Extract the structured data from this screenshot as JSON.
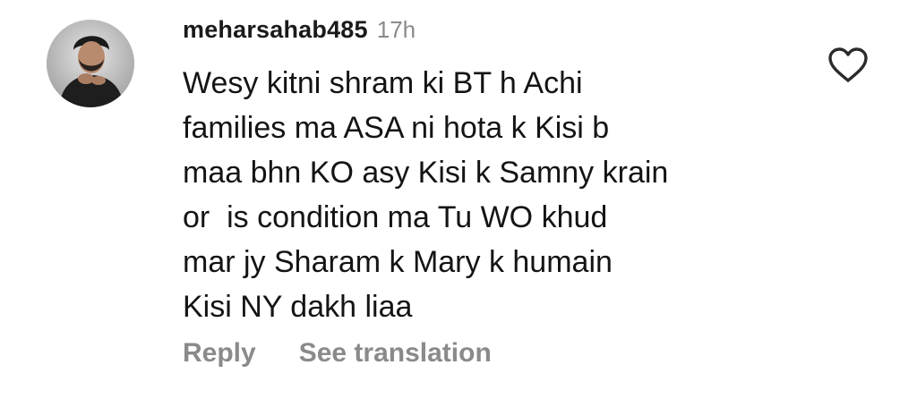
{
  "comment": {
    "username": "meharsahab485",
    "time": "17h",
    "lines": [
      "Wesy kitni shram ki BT h Achi",
      "families ma ASA ni hota k Kisi b",
      "maa bhn KO asy Kisi k Samny krain",
      "or  is condition ma Tu WO khud",
      "mar jy Sharam k Mary k humain",
      "Kisi NY dakh liaa"
    ],
    "reply_label": "Reply",
    "translate_label": "See translation",
    "like_icon": "heart-outline-icon"
  },
  "colors": {
    "text": "#141414",
    "secondary": "#8a8a8a",
    "background": "#ffffff"
  }
}
